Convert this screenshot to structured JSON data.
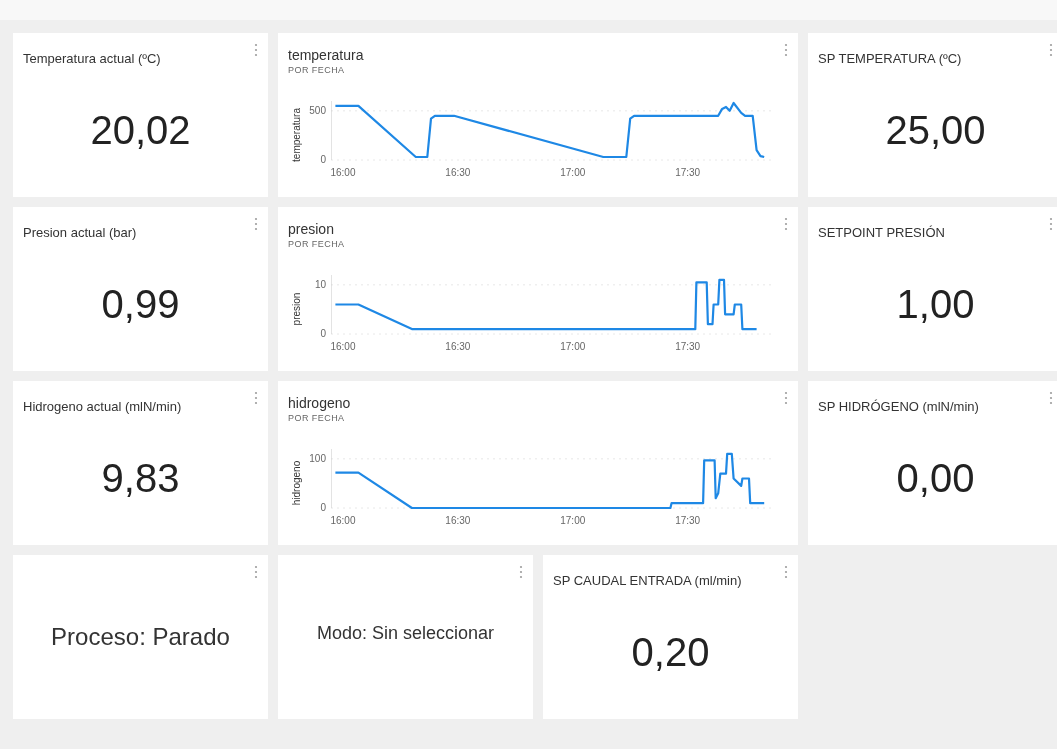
{
  "tiles": [
    {
      "kind": "value",
      "title": "Temperatura actual (ºC)",
      "value": "20,02"
    },
    {
      "kind": "chart",
      "title": "temperatura",
      "subtitle": "POR FECHA",
      "chart_data": {
        "type": "line",
        "ylabel": "temperatura",
        "ylim": [
          0,
          600
        ],
        "xlim": [
          15.95,
          17.867
        ],
        "yticks": [
          0,
          500
        ],
        "xticks": [
          {
            "value": 16,
            "label": "16:00"
          },
          {
            "value": 16.5,
            "label": "16:30"
          },
          {
            "value": 17,
            "label": "17:00"
          },
          {
            "value": 17.5,
            "label": "17:30"
          }
        ],
        "x": [
          15.967,
          16.067,
          16.317,
          16.367,
          16.383,
          16.4,
          16.483,
          17.133,
          17.233,
          17.25,
          17.267,
          17.633,
          17.65,
          17.667,
          17.683,
          17.7,
          17.733,
          17.75,
          17.783,
          17.8,
          17.817,
          17.833
        ],
        "series": [
          {
            "color": "#1e88e5",
            "values": [
              550,
              550,
              30,
              30,
              420,
              450,
              450,
              30,
              30,
              420,
              450,
              450,
              520,
              540,
              500,
              580,
              480,
              450,
              450,
              100,
              40,
              30
            ]
          }
        ]
      }
    },
    {
      "kind": "value",
      "title": "SP TEMPERATURA (ºC)",
      "value": "25,00"
    },
    {
      "kind": "value",
      "title": "Presion actual (bar)",
      "value": "0,99"
    },
    {
      "kind": "chart",
      "title": "presion",
      "subtitle": "POR FECHA",
      "chart_data": {
        "type": "line",
        "ylabel": "presion",
        "ylim": [
          0,
          12
        ],
        "xlim": [
          15.95,
          17.867
        ],
        "yticks": [
          0,
          10
        ],
        "xticks": [
          {
            "value": 16,
            "label": "16:00"
          },
          {
            "value": 16.5,
            "label": "16:30"
          },
          {
            "value": 17,
            "label": "17:00"
          },
          {
            "value": 17.5,
            "label": "17:30"
          }
        ],
        "x": [
          15.967,
          16.067,
          16.3,
          17.533,
          17.538,
          17.583,
          17.588,
          17.608,
          17.613,
          17.633,
          17.638,
          17.658,
          17.663,
          17.7,
          17.705,
          17.733,
          17.738,
          17.8
        ],
        "series": [
          {
            "color": "#1e88e5",
            "values": [
              6,
              6,
              1,
              1,
              10.5,
              10.5,
              2,
              2,
              6,
              6,
              11,
              11,
              4,
              4,
              6,
              6,
              1,
              1
            ]
          }
        ]
      }
    },
    {
      "kind": "value",
      "title": "SETPOINT PRESIÓN",
      "value": "1,00"
    },
    {
      "kind": "value",
      "title": "Hidrogeno actual (mlN/min)",
      "value": "9,83"
    },
    {
      "kind": "chart",
      "title": "hidrogeno",
      "subtitle": "POR FECHA",
      "chart_data": {
        "type": "line",
        "ylabel": "hidrogeno",
        "ylim": [
          0,
          120
        ],
        "xlim": [
          15.95,
          17.867
        ],
        "yticks": [
          0,
          100
        ],
        "xticks": [
          {
            "value": 16,
            "label": "16:00"
          },
          {
            "value": 16.5,
            "label": "16:30"
          },
          {
            "value": 17,
            "label": "17:00"
          },
          {
            "value": 17.5,
            "label": "17:30"
          }
        ],
        "x": [
          15.967,
          16.067,
          16.3,
          17.425,
          17.43,
          17.567,
          17.572,
          17.617,
          17.622,
          17.633,
          17.642,
          17.65,
          17.667,
          17.672,
          17.692,
          17.7,
          17.733,
          17.738,
          17.767,
          17.772,
          17.833
        ],
        "series": [
          {
            "color": "#1e88e5",
            "values": [
              72,
              72,
              0,
              0,
              10,
              10,
              97,
              97,
              20,
              30,
              70,
              70,
              70,
              110,
              110,
              60,
              45,
              60,
              60,
              10,
              10
            ]
          }
        ]
      }
    },
    {
      "kind": "value",
      "title": "SP HIDRÓGENO (mlN/min)",
      "value": "0,00"
    },
    {
      "kind": "status",
      "text": "Proceso: Parado"
    },
    {
      "kind": "mode",
      "text": "Modo: Sin seleccionar"
    },
    {
      "kind": "value",
      "title": "SP CAUDAL ENTRADA (ml/min)",
      "value": "0,20"
    }
  ]
}
